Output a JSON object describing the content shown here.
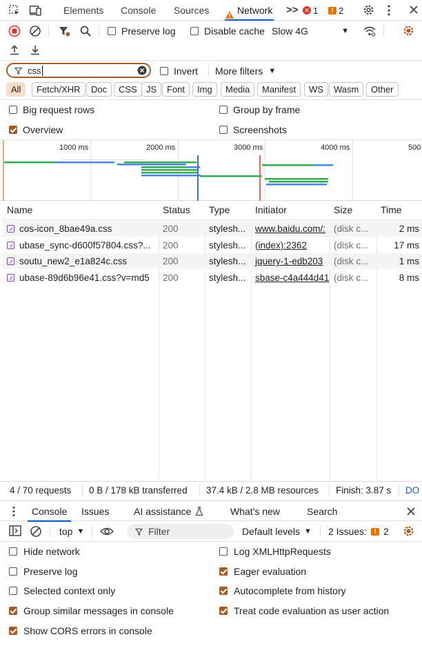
{
  "tabs": {
    "elements": "Elements",
    "console": "Console",
    "sources": "Sources",
    "network": "Network",
    "more": ">>",
    "errors_count": "1",
    "warnings_count": "2"
  },
  "toolbar": {
    "preserve_log": "Preserve log",
    "disable_cache": "Disable cache",
    "throttling": "Slow 4G"
  },
  "filter": {
    "value": "css",
    "invert": "Invert",
    "more_filters": "More filters"
  },
  "type_filters": [
    "All",
    "Fetch/XHR",
    "Doc",
    "CSS",
    "JS",
    "Font",
    "Img",
    "Media",
    "Manifest",
    "WS",
    "Wasm",
    "Other"
  ],
  "settings": {
    "big_request_rows": "Big request rows",
    "group_by_frame": "Group by frame",
    "overview": "Overview",
    "screenshots": "Screenshots",
    "big_request_rows_checked": false,
    "group_by_frame_checked": false,
    "overview_checked": true,
    "screenshots_checked": false
  },
  "timeline": {
    "ticks": [
      "1000 ms",
      "2000 ms",
      "3000 ms",
      "4000 ms",
      "500"
    ]
  },
  "table": {
    "headers": [
      "Name",
      "Status",
      "Type",
      "Initiator",
      "Size",
      "Time"
    ],
    "rows": [
      {
        "name": "cos-icon_8bae49a.css",
        "status": "200",
        "type": "stylesh...",
        "initiator": "www.baidu.com/:",
        "size": "(disk c...",
        "time": "2 ms"
      },
      {
        "name": "ubase_sync-d600f57804.css?...",
        "status": "200",
        "type": "stylesh...",
        "initiator": "(index):2362",
        "size": "(disk c...",
        "time": "17 ms"
      },
      {
        "name": "soutu_new2_e1a824c.css",
        "status": "200",
        "type": "stylesh...",
        "initiator": "jquery-1-edb203",
        "size": "(disk c...",
        "time": "1 ms"
      },
      {
        "name": "ubase-89d6b96e41.css?v=md5",
        "status": "200",
        "type": "stylesh...",
        "initiator": "sbase-c4a444d41",
        "size": "(disk c...",
        "time": "8 ms"
      }
    ]
  },
  "status": {
    "requests": "4 / 70 requests",
    "transferred": "0 B / 178 kB transferred",
    "resources": "37.4 kB / 2.8 MB resources",
    "finish": "Finish: 3.87 s",
    "dom": "DO"
  },
  "drawer": {
    "tabs": [
      "Console",
      "Issues",
      "AI assistance",
      "What's new",
      "Search"
    ],
    "context": "top",
    "filter_placeholder": "Filter",
    "levels": "Default levels",
    "issues_label": "2 Issues:",
    "issues_count": "2"
  },
  "console_settings": [
    {
      "label": "Hide network",
      "checked": false
    },
    {
      "label": "Log XMLHttpRequests",
      "checked": false
    },
    {
      "label": "Preserve log",
      "checked": false
    },
    {
      "label": "Eager evaluation",
      "checked": true
    },
    {
      "label": "Selected context only",
      "checked": false
    },
    {
      "label": "Autocomplete from history",
      "checked": true
    },
    {
      "label": "Group similar messages in console",
      "checked": true
    },
    {
      "label": "Treat code evaluation as user action",
      "checked": true
    },
    {
      "label": "Show CORS errors in console",
      "checked": true
    }
  ],
  "colors": {
    "accent_orange": "#a65a26",
    "active_tab_blue": "#0b57d0",
    "bar_green": "#34a853",
    "bar_blue": "#4a86e8",
    "error_red": "#dc362e",
    "warning_orange": "#e37400"
  }
}
